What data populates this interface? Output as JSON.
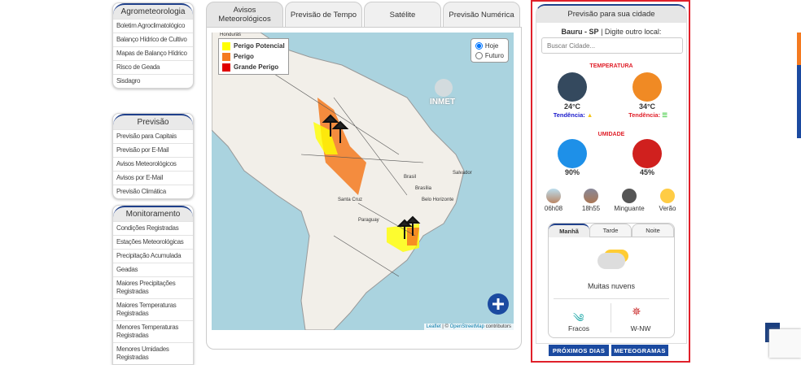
{
  "sidebar": [
    {
      "title": "Agrometeorologia",
      "items": [
        "Boletim Agroclimatológico",
        "Balanço Hídrico de Cultivo",
        "Mapas de Balanço Hídrico",
        "Risco de Geada",
        "Sisdagro"
      ]
    },
    {
      "title": "Previsão",
      "items": [
        "Previsão para Capitais",
        "Previsão por E-Mail",
        "Avisos Meteorológicos",
        "Avisos por E-Mail",
        "Previsão Climática"
      ]
    },
    {
      "title": "Monitoramento",
      "items": [
        "Condições Registradas",
        "Estações Meteorológicas",
        "Precipitação Acumulada",
        "Geadas",
        "Maiores Precipitações Registradas",
        "Maiores Temperaturas Registradas",
        "Menores Temperaturas Registradas",
        "Menores Umidades Registradas"
      ]
    }
  ],
  "tabs": [
    "Avisos Meteorológicos",
    "Previsão de Tempo",
    "Satélite",
    "Previsão Numérica"
  ],
  "map": {
    "legend": [
      {
        "label": "Perigo Potencial",
        "color": "#ffff00"
      },
      {
        "label": "Perigo",
        "color": "#f47a20"
      },
      {
        "label": "Grande Perigo",
        "color": "#e00000"
      }
    ],
    "radio": {
      "options": [
        "Hoje",
        "Futuro"
      ],
      "selected": "Hoje"
    },
    "watermark": "INMET",
    "place_labels": [
      "Honduras",
      "Brasil",
      "Salvador",
      "Brasília",
      "Belo Horizonte",
      "Santa Cruz",
      "Paraguay"
    ],
    "attribution": {
      "leaflet": "Leaflet",
      "sep": " | © ",
      "osm": "OpenStreetMap",
      "suffix": " contributors"
    }
  },
  "forecast": {
    "header": "Previsão para sua cidade",
    "city": "Bauru - SP",
    "other_prompt": " | Digite outro local:",
    "search_placeholder": "Buscar Cidade...",
    "temp_title": "TEMPERATURA",
    "min_temp": "24°C",
    "max_temp": "34°C",
    "trend_label": "Tendência:",
    "humidity_title": "UMIDADE",
    "min_hum": "90%",
    "max_hum": "45%",
    "sunrise": "06h08",
    "sunset": "18h55",
    "moon": "Minguante",
    "season": "Verão",
    "periods": [
      "Manhã",
      "Tarde",
      "Noite"
    ],
    "condition": "Muitas nuvens",
    "wind_strength": "Fracos",
    "wind_dir": "W-NW",
    "buttons": [
      "PRÓXIMOS DIAS",
      "METEOGRAMAS"
    ],
    "colors": {
      "accent": "#e0202a",
      "brand": "#1b4aa0"
    }
  }
}
